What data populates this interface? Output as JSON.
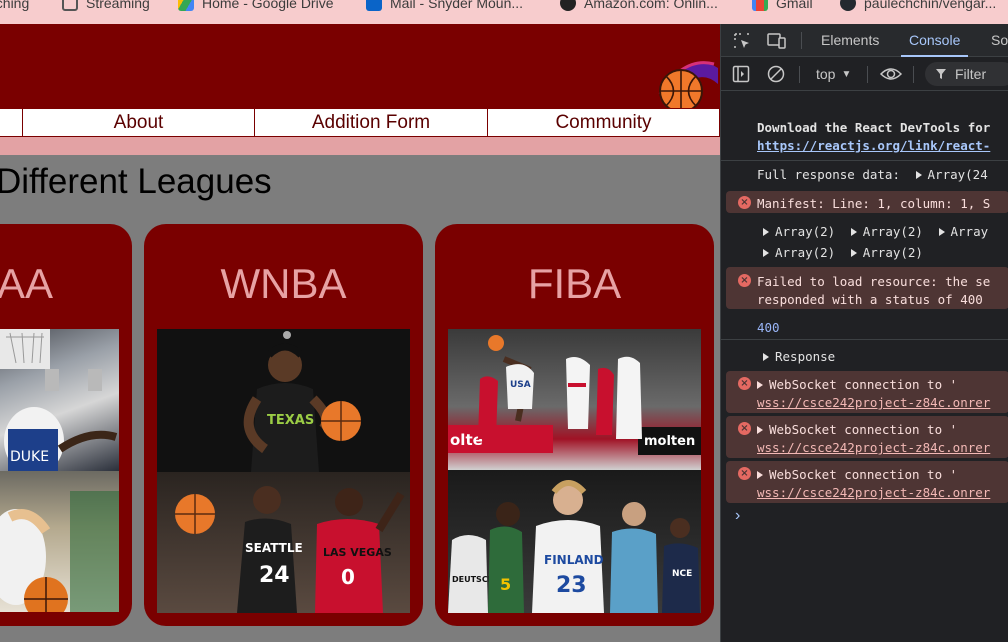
{
  "bookmarks": [
    {
      "label": "eching",
      "icon": "none"
    },
    {
      "label": "Streaming",
      "icon": "folder-icon"
    },
    {
      "label": "Home - Google Drive",
      "icon": "drive-icon"
    },
    {
      "label": "Mail - Snyder Moun...",
      "icon": "outlook-icon"
    },
    {
      "label": "Amazon.com: Onlin...",
      "icon": "amazon-icon"
    },
    {
      "label": "Gmail",
      "icon": "gmail-icon"
    },
    {
      "label": "paulechchin/vengar...",
      "icon": "github-icon"
    }
  ],
  "site": {
    "nav": [
      "About",
      "Addition Form",
      "Community"
    ],
    "heading": "Different Leagues",
    "cards": [
      {
        "title": "AA"
      },
      {
        "title": "WNBA"
      },
      {
        "title": "FIBA"
      }
    ],
    "colors": {
      "banner": "#7a0000",
      "band": "#e3a2a4",
      "background": "#7d7d7d",
      "card_title": "#e7a2a4"
    }
  },
  "devtools": {
    "tabs": [
      "Elements",
      "Console",
      "So"
    ],
    "active_tab": "Console",
    "context": "top",
    "filter_label": "Filter",
    "console": {
      "react_msg": "Download the React DevTools for",
      "react_link": "https://reactjs.org/link/react-",
      "full_response": "Full response data:",
      "full_response_value": "Array(24",
      "manifest_error": "Manifest: Line: 1, column: 1, S",
      "arrays_row1": [
        "Array(2)",
        "Array(2)",
        "Array"
      ],
      "arrays_row2": [
        "Array(2)",
        "Array(2)"
      ],
      "failed_line1": "Failed to load resource: the se",
      "failed_line2": "responded with a status of 400",
      "status_400": "400",
      "response_label": "Response",
      "ws_errors": [
        {
          "text": "WebSocket connection to '",
          "url": "wss://csce242project-z84c.onrer"
        },
        {
          "text": "WebSocket connection to '",
          "url": "wss://csce242project-z84c.onrer"
        },
        {
          "text": "WebSocket connection to '",
          "url": "wss://csce242project-z84c.onrer"
        }
      ],
      "prompt": "›"
    }
  }
}
